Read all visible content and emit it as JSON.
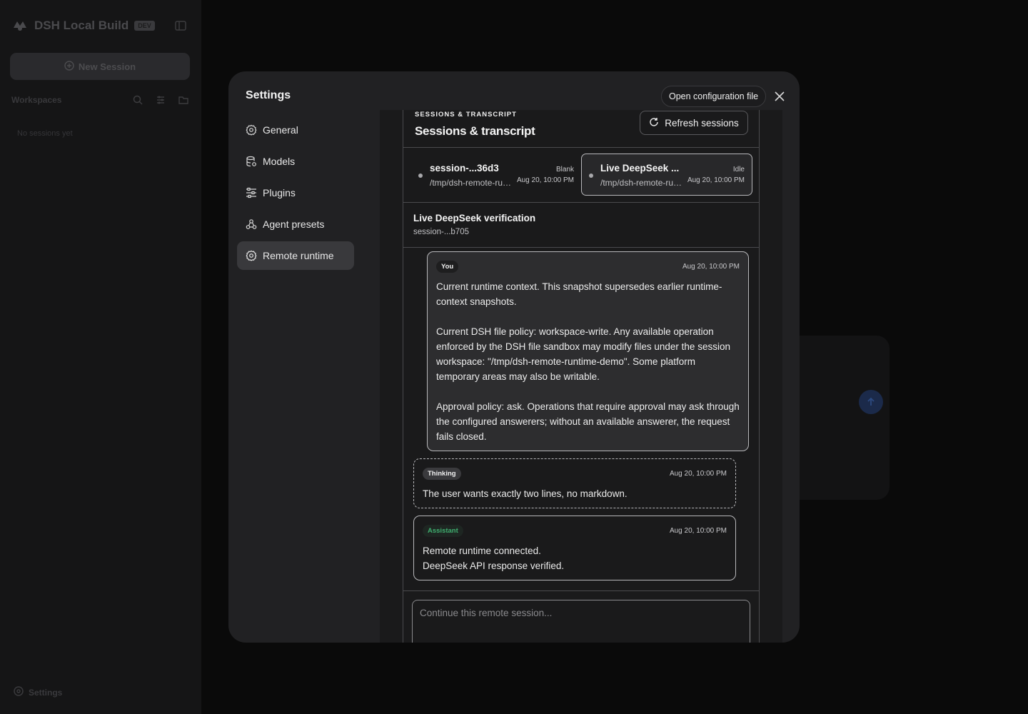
{
  "app": {
    "brand": "DSH Local Build",
    "badge": "DEV",
    "new_session": "New Session",
    "workspaces": "Workspaces",
    "empty": "No sessions yet",
    "settings": "Settings"
  },
  "modal": {
    "title": "Settings",
    "open_config": "Open configuration file",
    "nav": [
      {
        "label": "General",
        "icon": "gear-icon"
      },
      {
        "label": "Models",
        "icon": "database-icon"
      },
      {
        "label": "Plugins",
        "icon": "sliders-icon"
      },
      {
        "label": "Agent presets",
        "icon": "presets-icon"
      },
      {
        "label": "Remote runtime",
        "icon": "gear-icon",
        "active": true
      }
    ]
  },
  "panel": {
    "eyebrow": "Sessions & transcript",
    "title": "Sessions & transcript",
    "refresh": "Refresh sessions",
    "sessions": [
      {
        "name": "session-...36d3",
        "status": "Blank",
        "path": "/tmp/dsh-remote-runtime-demo",
        "time": "Aug 20, 10:00 PM"
      },
      {
        "name": "Live DeepSeek ...",
        "status": "Idle",
        "path": "/tmp/dsh-remote-runtime-demo",
        "time": "Aug 20, 10:00 PM",
        "selected": true
      }
    ],
    "detail": {
      "title": "Live DeepSeek verification",
      "id": "session-...b705"
    },
    "messages": {
      "you": {
        "role": "You",
        "time": "Aug 20, 10:00 PM",
        "p1": "Current runtime context. This snapshot supersedes earlier runtime-context snapshots.",
        "p2": "Current DSH file policy: workspace-write. Any available operation enforced by the DSH file sandbox may modify files under the session workspace: \"/tmp/dsh-remote-runtime-demo\". Some platform temporary areas may also be writable.",
        "p3": "Approval policy: ask. Operations that require approval may ask through the configured answerers; without an available answerer, the request fails closed."
      },
      "thinking": {
        "role": "Thinking",
        "time": "Aug 20, 10:00 PM",
        "text": "The user wants exactly two lines, no markdown."
      },
      "assistant": {
        "role": "Assistant",
        "time": "Aug 20, 10:00 PM",
        "line1": "Remote runtime connected.",
        "line2": "DeepSeek API response verified."
      }
    },
    "composer_placeholder": "Continue this remote session..."
  },
  "colors": {
    "accent_green": "#3fae6f",
    "active_nav": "#39393c"
  }
}
